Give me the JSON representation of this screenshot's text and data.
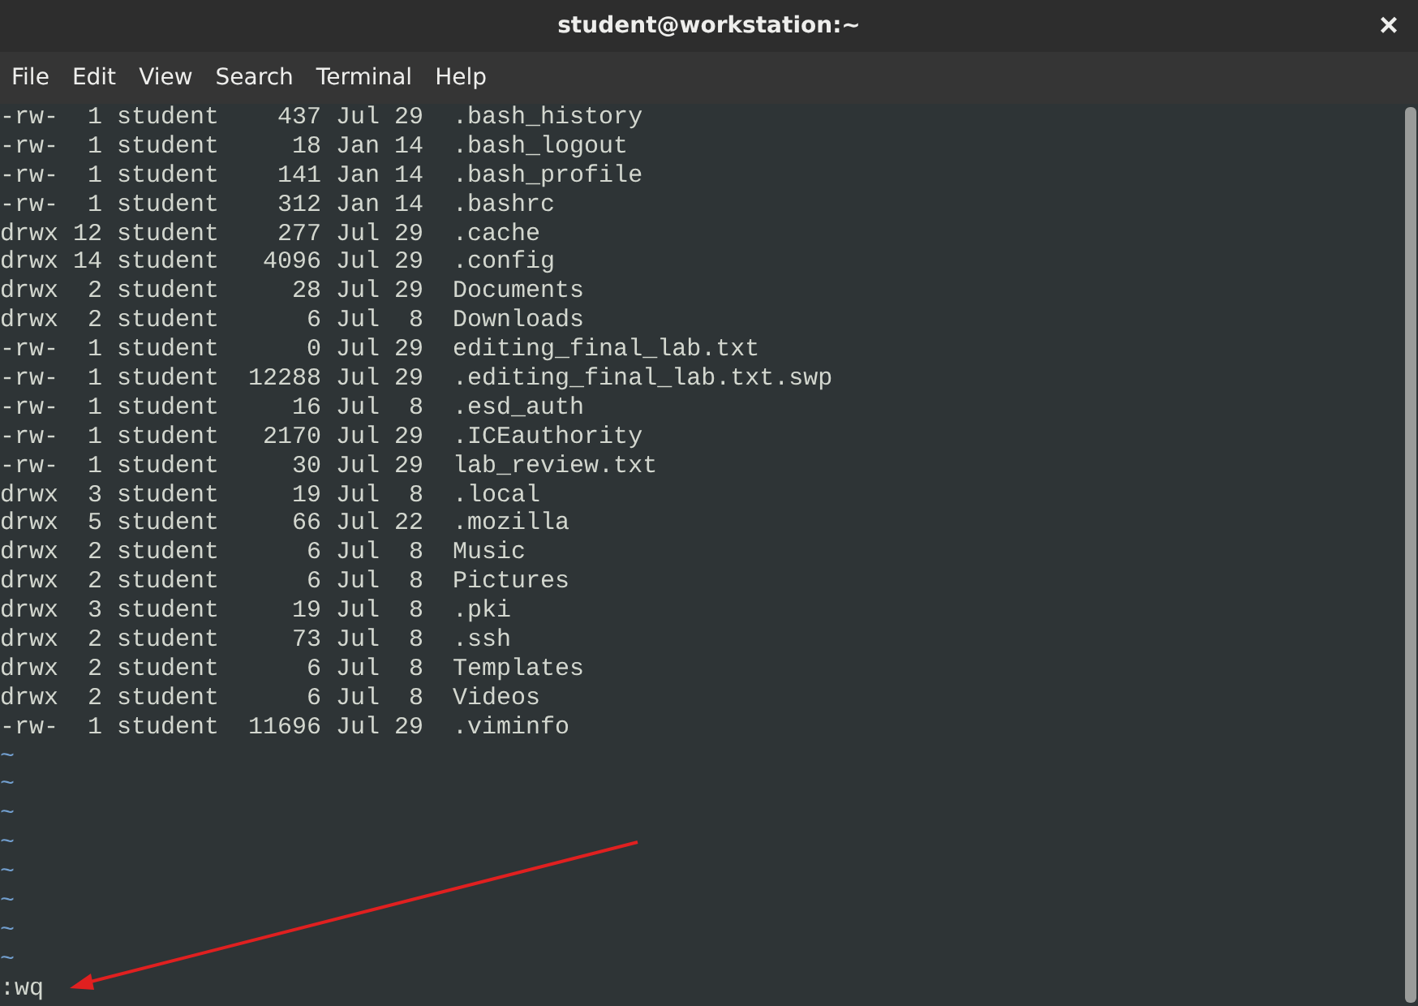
{
  "window": {
    "title": "student@workstation:~",
    "close": "×"
  },
  "menu": [
    "File",
    "Edit",
    "View",
    "Search",
    "Terminal",
    "Help"
  ],
  "lines": [
    "-rw-  1 student    437 Jul 29  .bash_history",
    "-rw-  1 student     18 Jan 14  .bash_logout",
    "-rw-  1 student    141 Jan 14  .bash_profile",
    "-rw-  1 student    312 Jan 14  .bashrc",
    "drwx 12 student    277 Jul 29  .cache",
    "drwx 14 student   4096 Jul 29  .config",
    "drwx  2 student     28 Jul 29  Documents",
    "drwx  2 student      6 Jul  8  Downloads",
    "-rw-  1 student      0 Jul 29  editing_final_lab.txt",
    "-rw-  1 student  12288 Jul 29  .editing_final_lab.txt.swp",
    "-rw-  1 student     16 Jul  8  .esd_auth",
    "-rw-  1 student   2170 Jul 29  .ICEauthority",
    "-rw-  1 student     30 Jul 29  lab_review.txt",
    "drwx  3 student     19 Jul  8  .local",
    "drwx  5 student     66 Jul 22  .mozilla",
    "drwx  2 student      6 Jul  8  Music",
    "drwx  2 student      6 Jul  8  Pictures",
    "drwx  3 student     19 Jul  8  .pki",
    "drwx  2 student     73 Jul  8  .ssh",
    "drwx  2 student      6 Jul  8  Templates",
    "drwx  2 student      6 Jul  8  Videos",
    "-rw-  1 student  11696 Jul 29  .viminfo"
  ],
  "empty_lines": [
    "~",
    "~",
    "~",
    "~",
    "~",
    "~",
    "~",
    "~"
  ],
  "command": ":wq"
}
